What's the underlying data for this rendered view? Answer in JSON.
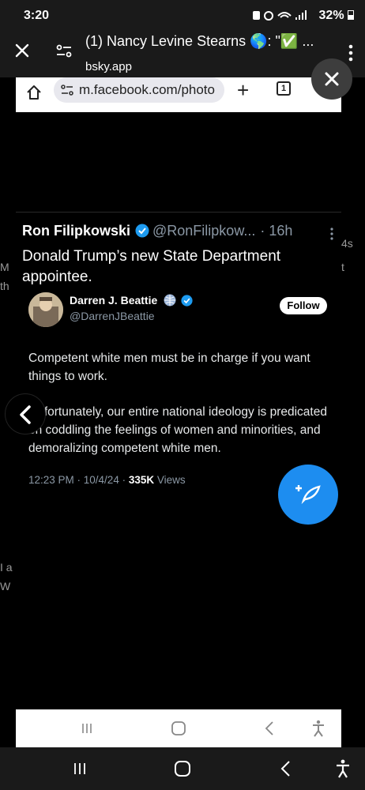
{
  "status_bar": {
    "time": "3:20",
    "battery": "32%"
  },
  "outer_browser": {
    "title": "(1) Nancy Levine Stearns 🌎: \"✅ ...",
    "url": "bsky.app"
  },
  "background_fragments": {
    "left_1": "M",
    "left_2": "th",
    "left_3": "I a",
    "left_4": "W",
    "right_1": "4s",
    "right_2": "t"
  },
  "inner_browser": {
    "url": "m.facebook.com/photo",
    "tab_count": "1"
  },
  "tweet": {
    "author_name": "Ron Filipkowski",
    "author_handle": "@RonFilipkow...",
    "time": "· 16h",
    "text": "Donald Trump’s new State Department appointee."
  },
  "quoted_post": {
    "author_name": "Darren J. Beattie",
    "author_handle": "@DarrenJBeattie",
    "follow_label": "Follow",
    "paragraph_1": "Competent white men must be in charge if you want things to work.",
    "paragraph_2": "Unfortunately, our entire national ideology is predicated on coddling the feelings of women and minorities, and demoralizing competent white men.",
    "timestamp": "12:23 PM · 10/4/24 · ",
    "views_count": "335K",
    "views_label": " Views"
  },
  "colors": {
    "verified": "#1d9bf0",
    "fab": "#1d8df0",
    "muted": "#8b98a5"
  }
}
